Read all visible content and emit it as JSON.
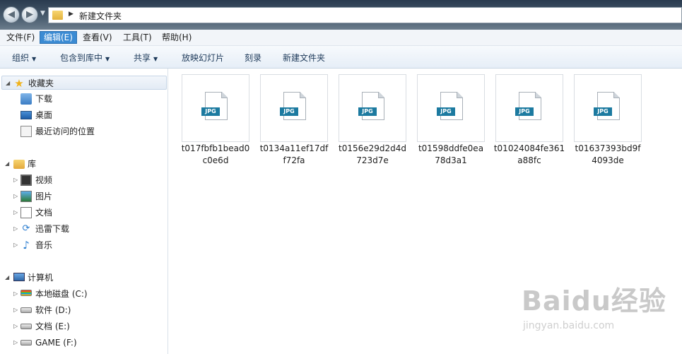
{
  "window": {
    "address_path": "新建文件夹"
  },
  "menu": [
    "文件(F)",
    "编辑(E)",
    "查看(V)",
    "工具(T)",
    "帮助(H)"
  ],
  "toolbar": {
    "organize": "组织",
    "include_in_library": "包含到库中",
    "share": "共享",
    "slideshow": "放映幻灯片",
    "burn": "刻录",
    "new_folder": "新建文件夹"
  },
  "nav": {
    "favorites": {
      "label": "收藏夹",
      "items": [
        "下载",
        "桌面",
        "最近访问的位置"
      ]
    },
    "libraries": {
      "label": "库",
      "items": [
        "视频",
        "图片",
        "文档",
        "迅雷下载",
        "音乐"
      ]
    },
    "computer": {
      "label": "计算机",
      "items": [
        "本地磁盘 (C:)",
        "软件 (D:)",
        "文档 (E:)",
        "GAME (F:)"
      ]
    }
  },
  "files": [
    {
      "name_line1": "t017fbfb1bead0",
      "name_line2": "c0e6d",
      "badge": "JPG"
    },
    {
      "name_line1": "t0134a11ef17df",
      "name_line2": "f72fa",
      "badge": "JPG"
    },
    {
      "name_line1": "t0156e29d2d4d",
      "name_line2": "723d7e",
      "badge": "JPG"
    },
    {
      "name_line1": "t01598ddfe0ea",
      "name_line2": "78d3a1",
      "badge": "JPG"
    },
    {
      "name_line1": "t01024084fe361",
      "name_line2": "a88fc",
      "badge": "JPG"
    },
    {
      "name_line1": "t01637393bd9f",
      "name_line2": "4093de",
      "badge": "JPG"
    }
  ],
  "watermark": {
    "logo_text": "Baidu经验",
    "url": "jingyan.baidu.com"
  }
}
